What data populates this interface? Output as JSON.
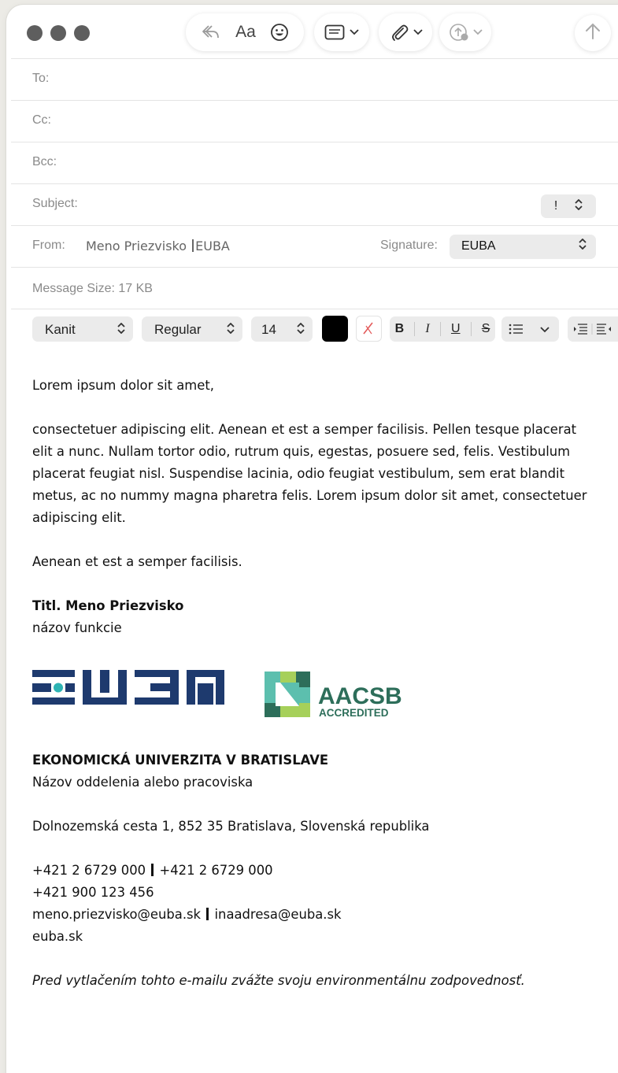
{
  "toolbar": {
    "font_label": "Aa",
    "buttons": [
      "reply-icon",
      "font-icon",
      "emoji-icon",
      "header-fields-icon",
      "attachment-icon",
      "markup-icon",
      "send-icon"
    ]
  },
  "header": {
    "to_label": "To:",
    "cc_label": "Cc:",
    "bcc_label": "Bcc:",
    "subject_label": "Subject:",
    "priority_value": "!",
    "from_label": "From:",
    "from_name": "Meno Priezvisko",
    "from_org": "EUBA",
    "signature_label": "Signature:",
    "signature_value": "EUBA",
    "message_size": "Message Size: 17 KB"
  },
  "format": {
    "font": "Kanit",
    "weight": "Regular",
    "size": "14",
    "text_color": "#000000",
    "bold": "B",
    "italic": "I",
    "underline": "U",
    "strike": "S"
  },
  "body": {
    "greeting": "Lorem ipsum dolor sit amet,",
    "paragraph_lines": [
      "consectetuer adipiscing elit. Aenean et est a semper facilisis. Pellen tesque placerat",
      "elit a nunc. Nullam tortor odio, rutrum quis, egestas, posuere sed, felis. Vestibulum",
      "placerat feugiat nisl. Suspendise lacinia, odio feugiat vestibulum, sem erat blandit",
      "metus, ac no nummy magna pharetra felis. Lorem ipsum dolor sit amet, consectetuer",
      "adipiscing elit."
    ],
    "closing": "Aenean et est a semper facilisis.",
    "sig_name": "Titl. Meno Priezvisko",
    "sig_role": "názov funkcie"
  },
  "logos": {
    "aacsb_line1": "AACSB",
    "aacsb_line2": "ACCREDITED",
    "euba_color": "#1e3a6e",
    "euba_dot_color": "#2eb4b4",
    "aacsb_dark": "#2d6e5a",
    "aacsb_teal": "#5cbfae",
    "aacsb_lime": "#a6d05a"
  },
  "org": {
    "name": "EKONOMICKÁ UNIVERZITA V BRATISLAVE",
    "department": "Názov oddelenia alebo pracoviska",
    "address": "Dolnozemská cesta 1, 852 35 Bratislava, Slovenská republika",
    "phone1": "+421 2 6729 000",
    "phone2": "+421 2 6729 000",
    "mobile": "+421 900 123 456",
    "email1": "meno.priezvisko@euba.sk",
    "email2": "inaadresa@euba.sk",
    "web": "euba.sk",
    "disclaimer": "Pred vytlačením tohto e-mailu zvážte svoju environmentálnu zodpovednosť."
  }
}
